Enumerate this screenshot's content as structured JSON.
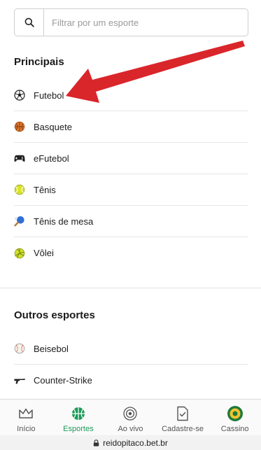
{
  "search": {
    "placeholder": "Filtrar por um esporte"
  },
  "main_section": {
    "title": "Principais",
    "items": [
      {
        "label": "Futebol",
        "icon": "soccer-ball-icon"
      },
      {
        "label": "Basquete",
        "icon": "basketball-icon"
      },
      {
        "label": "eFutebol",
        "icon": "gamepad-icon"
      },
      {
        "label": "Tênis",
        "icon": "tennis-ball-icon"
      },
      {
        "label": "Tênis de mesa",
        "icon": "table-tennis-icon"
      },
      {
        "label": "Vôlei",
        "icon": "volleyball-icon"
      }
    ]
  },
  "other_section": {
    "title": "Outros esportes",
    "items": [
      {
        "label": "Beisebol",
        "icon": "baseball-icon"
      },
      {
        "label": "Counter-Strike",
        "icon": "rifle-icon"
      }
    ]
  },
  "bottom_nav": {
    "items": [
      {
        "label": "Início",
        "icon": "crown-icon",
        "active": false
      },
      {
        "label": "Esportes",
        "icon": "basketball-icon",
        "active": true
      },
      {
        "label": "Ao vivo",
        "icon": "live-icon",
        "active": false
      },
      {
        "label": "Cadastre-se",
        "icon": "document-check-icon",
        "active": false
      },
      {
        "label": "Cassino",
        "icon": "casino-icon",
        "active": false
      }
    ]
  },
  "browser": {
    "url": "reidopitaco.bet.br"
  },
  "colors": {
    "accent": "#1d9a5a",
    "arrow": "#d9262b"
  }
}
